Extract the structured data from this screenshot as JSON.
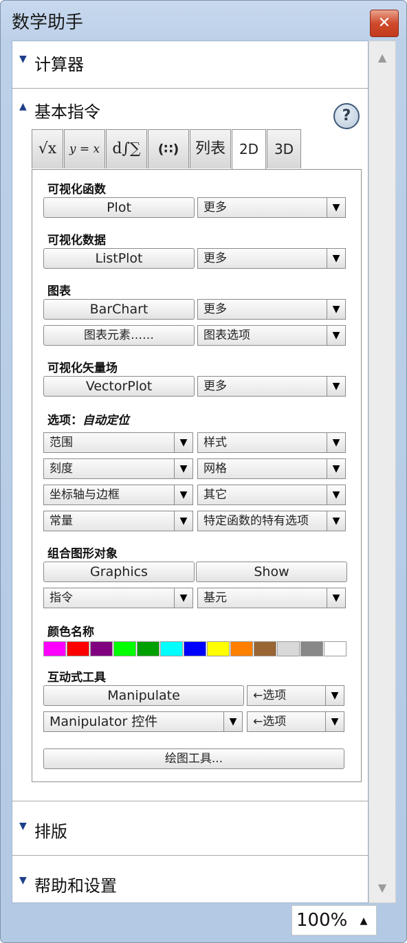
{
  "window": {
    "title": "数学助手",
    "close_symbol": "✕"
  },
  "sections": {
    "calculator": {
      "label": "计算器",
      "tri": "▼"
    },
    "basic": {
      "label": "基本指令",
      "tri": "▲"
    },
    "typesetting": {
      "label": "排版",
      "tri": "▼"
    },
    "help": {
      "label": "帮助和设置",
      "tri": "▼"
    }
  },
  "help_button": "?",
  "tabs": [
    "√x",
    "y = x",
    "d∫∑",
    "(∷)",
    "列表",
    "2D",
    "3D"
  ],
  "active_tab": "2D",
  "groups": {
    "vis_func": {
      "heading": "可视化函数",
      "button": "Plot",
      "dropdown": "更多"
    },
    "vis_data": {
      "heading": "可视化数据",
      "button": "ListPlot",
      "dropdown": "更多"
    },
    "charts": {
      "heading": "图表",
      "button": "BarChart",
      "dropdown": "更多",
      "button2": "图表元素……",
      "dropdown2": "图表选项"
    },
    "vector": {
      "heading": "可视化矢量场",
      "button": "VectorPlot",
      "dropdown": "更多"
    },
    "options": {
      "heading": "选项：",
      "heading_em": "自动定位",
      "dd": [
        "范围",
        "样式",
        "刻度",
        "网格",
        "坐标轴与边框",
        "其它",
        "常量",
        "特定函数的特有选项"
      ]
    },
    "combine": {
      "heading": "组合图形对象",
      "btn1": "Graphics",
      "btn2": "Show",
      "dd1": "指令",
      "dd2": "基元"
    },
    "colors": {
      "heading": "颜色名称",
      "swatches": [
        "#ff00ff",
        "#ff0000",
        "#800080",
        "#00ff00",
        "#00a000",
        "#00ffff",
        "#0000ff",
        "#ffff00",
        "#ff8000",
        "#996633",
        "#d9d9d9",
        "#888888",
        "#ffffff"
      ]
    },
    "interactive": {
      "heading": "互动式工具",
      "btn1": "Manipulate",
      "dd1": "←选项",
      "btn2": "Manipulator 控件",
      "dd2": "←选项",
      "drawing": "绘图工具..."
    }
  },
  "zoom": {
    "value": "100%",
    "arrow": "▲"
  }
}
